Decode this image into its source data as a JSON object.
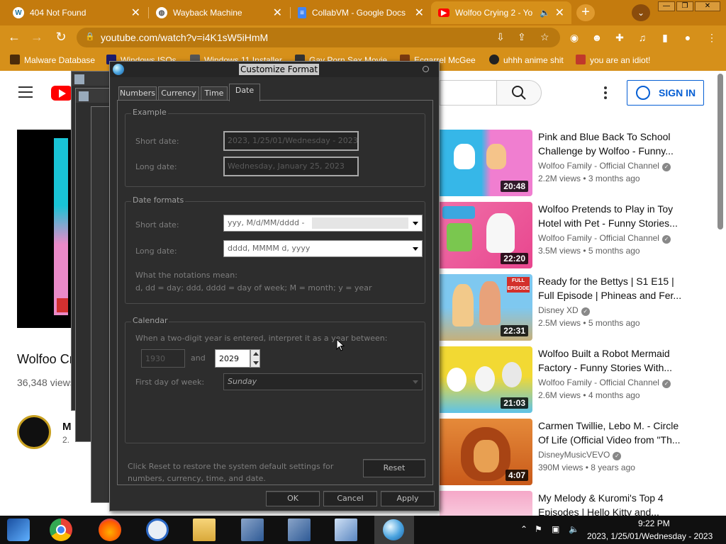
{
  "browser": {
    "tabs": [
      {
        "title": "404 Not Found",
        "icon": "wordpress-icon"
      },
      {
        "title": "Wayback Machine",
        "icon": "globe-icon"
      },
      {
        "title": "CollabVM - Google Docs",
        "icon": "docs-icon"
      },
      {
        "title": "Wolfoo Crying 2 - Yo",
        "icon": "youtube-icon",
        "active": true
      }
    ],
    "url": "youtube.com/watch?v=i4K1sW5iHmM",
    "bookmarks": [
      {
        "label": "Malware Database"
      },
      {
        "label": "Windows ISOs"
      },
      {
        "label": "Windows 11 Installer"
      },
      {
        "label": "Gay Porn Sex Movie"
      },
      {
        "label": "Ecgarrel McGee"
      },
      {
        "label": "uhhh anime shit"
      },
      {
        "label": "you are an idiot!"
      }
    ],
    "accent": "#d6901a"
  },
  "youtube": {
    "signin_label": "SIGN IN",
    "video_title": "Wolfoo Cr",
    "views": "36,348 views",
    "channel_name": "M",
    "channel_subs": "2.",
    "recommendations": [
      {
        "title": "Pink and Blue Back To School Challenge by Wolfoo - Funny...",
        "channel": "Wolfoo Family - Official Channel",
        "meta": "2.2M views • 3 months ago",
        "duration": "20:48"
      },
      {
        "title": "Wolfoo Pretends to Play in Toy Hotel with Pet - Funny Stories...",
        "channel": "Wolfoo Family - Official Channel",
        "meta": "3.5M views • 5 months ago",
        "duration": "22:20"
      },
      {
        "title": "Ready for the Bettys | S1 E15 | Full Episode | Phineas and Fer...",
        "channel": "Disney XD",
        "meta": "2.5M views • 5 months ago",
        "duration": "22:31"
      },
      {
        "title": "Wolfoo Built a Robot Mermaid Factory - Funny Stories With...",
        "channel": "Wolfoo Family - Official Channel",
        "meta": "2.6M views • 4 months ago",
        "duration": "21:03"
      },
      {
        "title": "Carmen Twillie, Lebo M. - Circle Of Life (Official Video from \"Th...",
        "channel": "DisneyMusicVEVO",
        "meta": "390M views • 8 years ago",
        "duration": "4:07"
      },
      {
        "title": "My Melody & Kuromi's Top 4 Episodes | Hello Kitty and...",
        "channel": "",
        "meta": "",
        "duration": ""
      }
    ]
  },
  "dialog": {
    "title": "Customize Format",
    "tabs": [
      "Numbers",
      "Currency",
      "Time",
      "Date"
    ],
    "active_tab": "Date",
    "example": {
      "label": "Example",
      "short_label": "Short date:",
      "short_value": "2023, 1/25/01/Wednesday - 2023",
      "long_label": "Long date:",
      "long_value": "Wednesday, January 25, 2023"
    },
    "formats": {
      "label": "Date formats",
      "short_label": "Short date:",
      "short_value": "yyy, M/d/MM/dddd -",
      "long_label": "Long date:",
      "long_value": "dddd, MMMM d, yyyy",
      "notation_title": "What the notations mean:",
      "notation_text": "d, dd = day;   ddd, dddd = day of week;   M = month;   y = year"
    },
    "calendar": {
      "label": "Calendar",
      "two_digit_text": "When a two-digit year is entered, interpret it as a year between:",
      "year_from": "1930",
      "and_label": "and",
      "year_to": "2029",
      "first_day_label": "First day of week:",
      "first_day_value": "Sunday"
    },
    "reset_text": "Click Reset to restore the system default settings for numbers, currency, time, and date.",
    "reset_label": "Reset",
    "ok_label": "OK",
    "cancel_label": "Cancel",
    "apply_label": "Apply"
  },
  "taskbar": {
    "time": "9:22 PM",
    "date": "2023, 1/25/01/Wednesday - 2023"
  }
}
